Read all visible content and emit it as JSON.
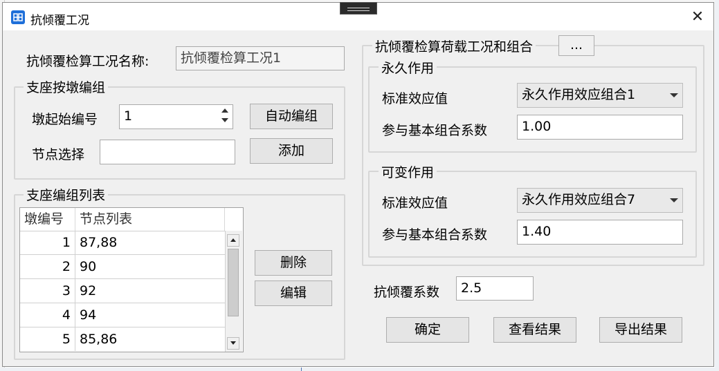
{
  "window": {
    "title": "抗倾覆工况",
    "close_glyph": "✕"
  },
  "case_name": {
    "label": "抗倾覆检算工况名称:",
    "value": "抗倾覆检算工况1"
  },
  "bearing_group": {
    "title": "支座按墩编组",
    "start_label": "墩起始编号",
    "start_value": "1",
    "auto_button": "自动编组",
    "node_label": "节点选择",
    "node_value": "",
    "add_button": "添加"
  },
  "bearing_list": {
    "title": "支座编组列表",
    "columns": [
      "墩编号",
      "节点列表"
    ],
    "rows": [
      {
        "pier": "1",
        "nodes": "87,88"
      },
      {
        "pier": "2",
        "nodes": "90"
      },
      {
        "pier": "3",
        "nodes": "92"
      },
      {
        "pier": "4",
        "nodes": "94"
      },
      {
        "pier": "5",
        "nodes": "85,86"
      }
    ],
    "delete_button": "删除",
    "edit_button": "编辑"
  },
  "load_combo": {
    "title": "抗倾覆检算荷载工况和组合",
    "more_button": "...",
    "permanent": {
      "title": "永久作用",
      "std_label": "标准效应值",
      "std_value": "永久作用效应组合1",
      "coef_label": "参与基本组合系数",
      "coef_value": "1.00"
    },
    "variable": {
      "title": "可变作用",
      "std_label": "标准效应值",
      "std_value": "永久作用效应组合7",
      "coef_label": "参与基本组合系数",
      "coef_value": "1.40"
    }
  },
  "overturn_coef": {
    "label": "抗倾覆系数",
    "value": "2.5"
  },
  "actions": {
    "ok": "确定",
    "view": "查看结果",
    "export": "导出结果"
  }
}
